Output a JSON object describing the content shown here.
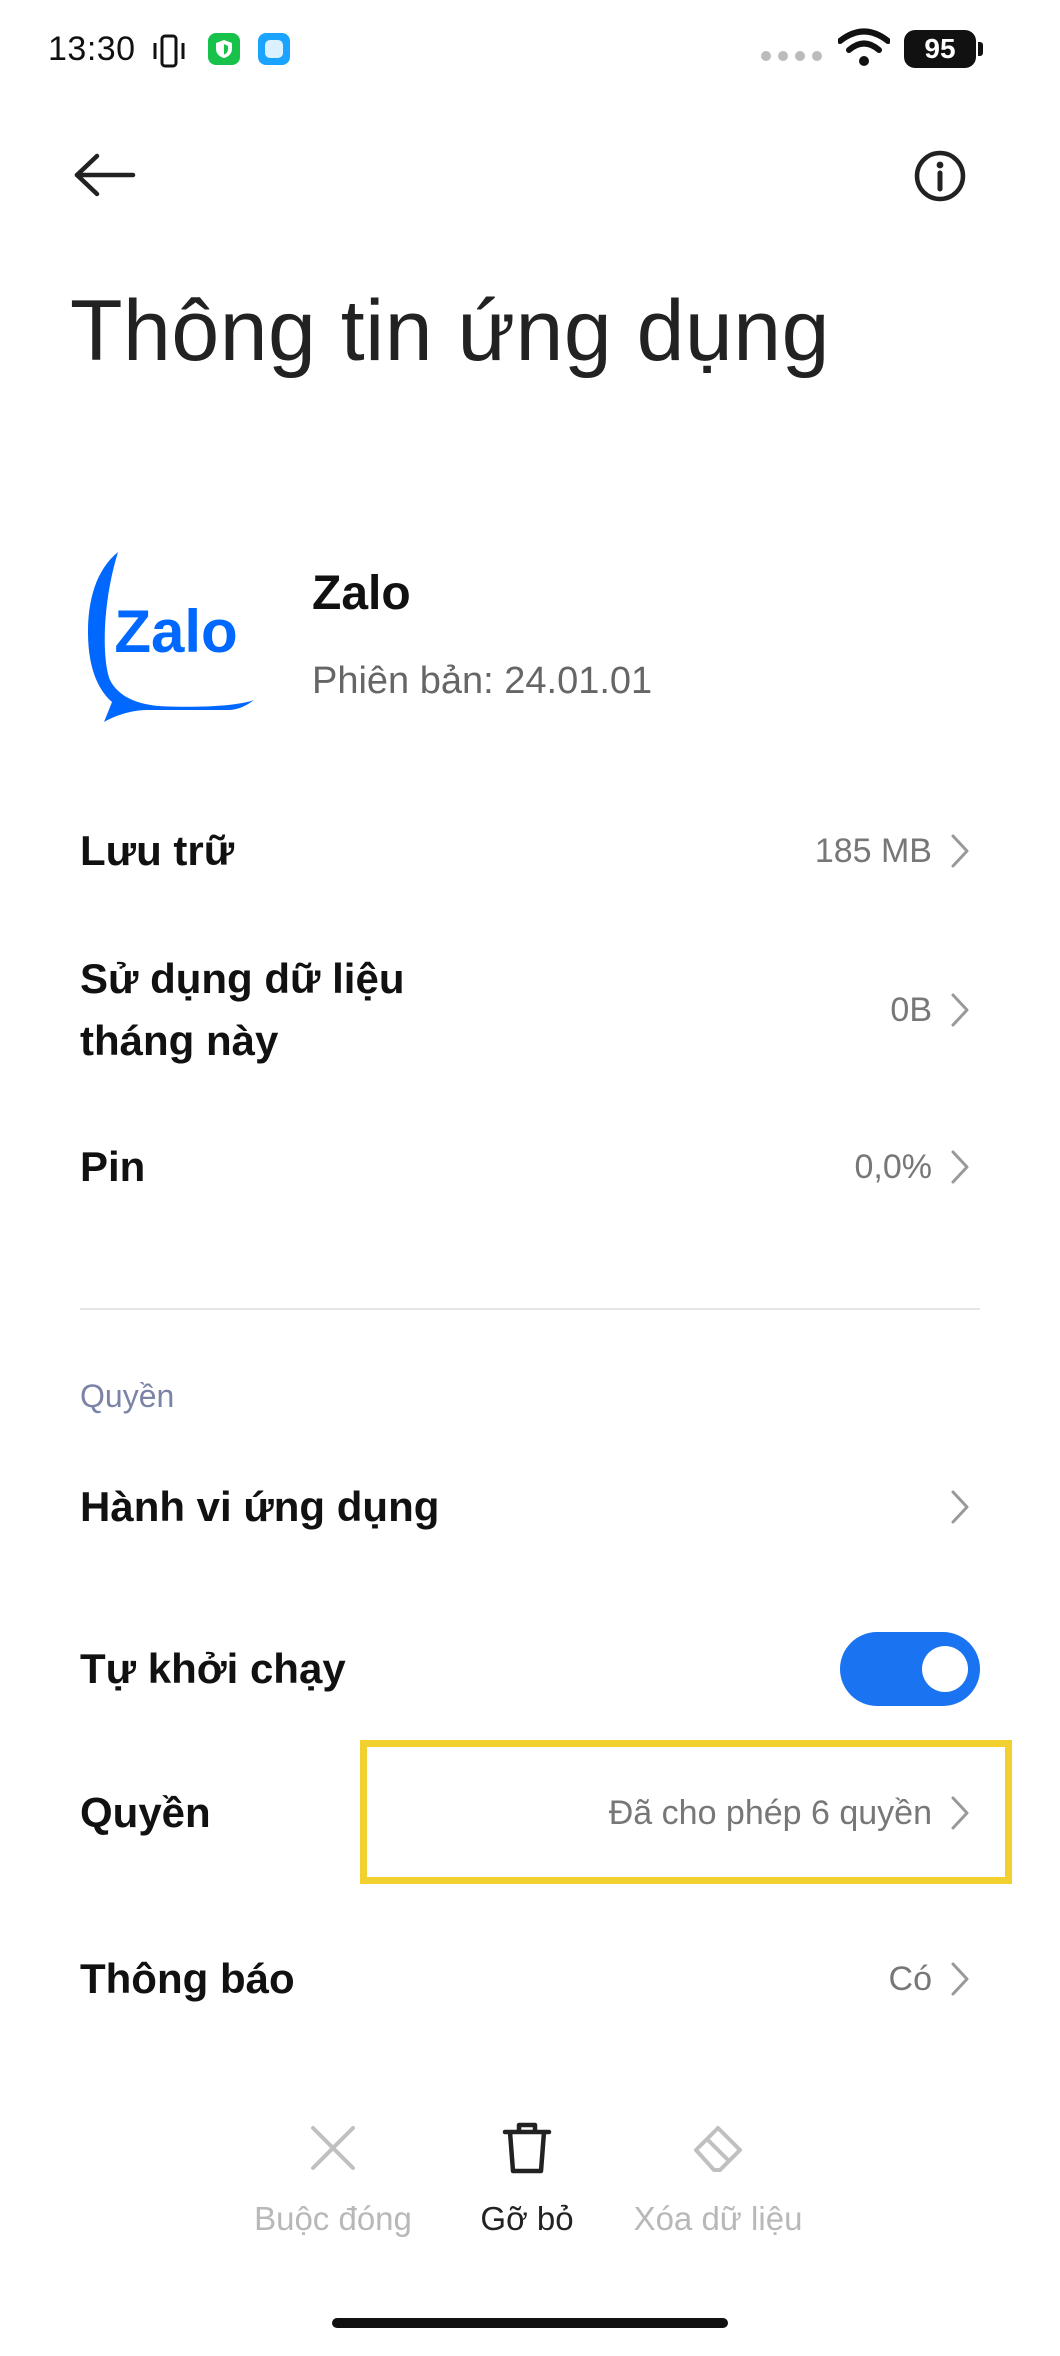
{
  "status_bar": {
    "time": "13:30",
    "battery": "95"
  },
  "header": {
    "title": "Thông tin ứng dụng"
  },
  "app": {
    "name": "Zalo",
    "version": "Phiên bản: 24.01.01",
    "logo_text": "Zalo"
  },
  "rows": {
    "storage": {
      "label": "Lưu trữ",
      "value": "185 MB"
    },
    "data_usage": {
      "label_line1": "Sử dụng dữ liệu",
      "label_line2": "tháng này",
      "value": "0B"
    },
    "battery": {
      "label": "Pin",
      "value": "0,0%"
    }
  },
  "permissions_section": {
    "header": "Quyền",
    "app_behavior": {
      "label": "Hành vi ứng dụng"
    },
    "autostart": {
      "label": "Tự khởi chạy",
      "enabled": true
    },
    "permissions": {
      "label": "Quyền",
      "value": "Đã cho phép 6 quyền"
    },
    "notifications": {
      "label": "Thông báo",
      "value": "Có"
    }
  },
  "actions": {
    "force_stop": "Buộc đóng",
    "uninstall": "Gỡ bỏ",
    "clear_data": "Xóa dữ liệu"
  },
  "colors": {
    "accent": "#1a73f0",
    "highlight": "#f2d030",
    "section_header": "#7b83a6",
    "zalo_blue": "#0068ff"
  }
}
